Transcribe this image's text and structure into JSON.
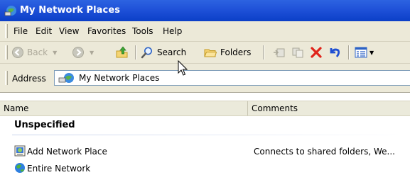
{
  "window": {
    "title": "My Network Places",
    "title_icon": "network-places-icon"
  },
  "menubar": {
    "items": [
      "File",
      "Edit",
      "View",
      "Favorites",
      "Tools",
      "Help"
    ]
  },
  "toolbar": {
    "back_label": "Back",
    "search_label": "Search",
    "folders_label": "Folders"
  },
  "addressbar": {
    "label": "Address",
    "value": "My Network Places"
  },
  "list": {
    "columns": [
      "Name",
      "Comments"
    ],
    "group": "Unspecified",
    "items": [
      {
        "name": "Add Network Place",
        "comment": "Connects to shared folders, We...",
        "icon": "add-network-place-icon"
      },
      {
        "name": "Entire Network",
        "comment": "",
        "icon": "globe-icon"
      }
    ]
  },
  "colors": {
    "titlebar": "#0b3fc7",
    "chrome": "#ece9d8",
    "delete_red": "#e0241b",
    "undo_blue": "#1f4fd2"
  }
}
